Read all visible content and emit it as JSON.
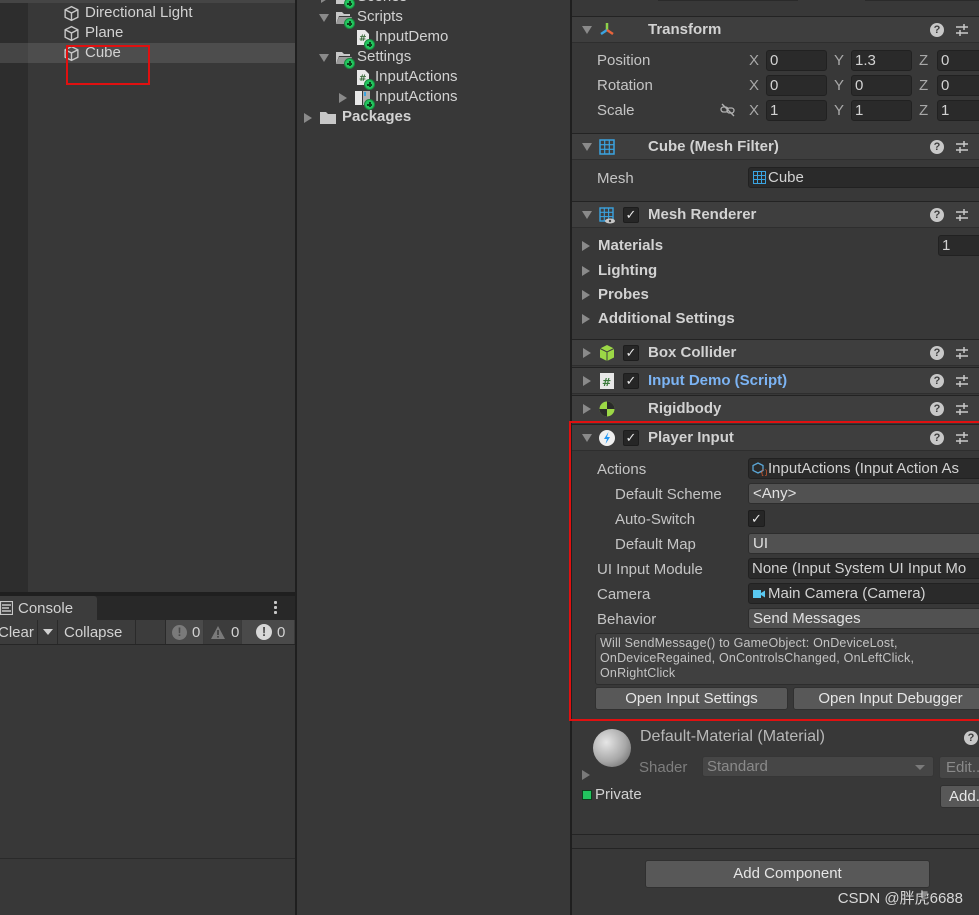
{
  "hierarchy": {
    "items": [
      {
        "label": "Directional Light",
        "icon": "gameobject-cube-icon"
      },
      {
        "label": "Plane",
        "icon": "gameobject-cube-icon"
      },
      {
        "label": "Cube",
        "icon": "gameobject-cube-icon",
        "selected": true
      }
    ],
    "highlight_color": "#e01010"
  },
  "console": {
    "tab_label": "Console",
    "clear_label": "Clear",
    "collapse_label": "Collapse",
    "info_count": "0",
    "warning_count": "0",
    "error_count": "0"
  },
  "project": {
    "items": [
      {
        "label": "Scenes",
        "type": "folder",
        "expanded": false
      },
      {
        "label": "Scripts",
        "type": "folder",
        "expanded": true
      },
      {
        "label": "InputDemo",
        "type": "script"
      },
      {
        "label": "Settings",
        "type": "folder",
        "expanded": true
      },
      {
        "label": "InputActions",
        "type": "script"
      },
      {
        "label": "InputActions",
        "type": "input-actions-asset",
        "expanded": false
      },
      {
        "label": "Packages",
        "type": "folder",
        "expanded": false
      }
    ]
  },
  "inspector": {
    "transform": {
      "title": "Transform",
      "position": {
        "label": "Position",
        "x": "0",
        "y": "1.3",
        "z": "0"
      },
      "rotation": {
        "label": "Rotation",
        "x": "0",
        "y": "0",
        "z": "0"
      },
      "scale": {
        "label": "Scale",
        "x": "1",
        "y": "1",
        "z": "1"
      }
    },
    "mesh_filter": {
      "title": "Cube (Mesh Filter)",
      "mesh_label": "Mesh",
      "mesh_value": "Cube"
    },
    "mesh_renderer": {
      "title": "Mesh Renderer",
      "enabled": true,
      "materials_label": "Materials",
      "materials_count": "1",
      "lighting_label": "Lighting",
      "probes_label": "Probes",
      "additional_label": "Additional Settings"
    },
    "box_collider": {
      "title": "Box Collider",
      "enabled": true
    },
    "input_demo": {
      "title": "Input Demo (Script)",
      "enabled": true,
      "title_color": "#7cb4f4"
    },
    "rigidbody": {
      "title": "Rigidbody"
    },
    "player_input": {
      "title": "Player Input",
      "enabled": true,
      "actions_label": "Actions",
      "actions_value": "InputActions (Input Action As",
      "default_scheme_label": "Default Scheme",
      "default_scheme_value": "<Any>",
      "auto_switch_label": "Auto-Switch",
      "auto_switch_checked": true,
      "default_map_label": "Default Map",
      "default_map_value": "UI",
      "ui_input_module_label": "UI Input Module",
      "ui_input_module_value": "None (Input System UI Input Mo",
      "camera_label": "Camera",
      "camera_value": "Main Camera (Camera)",
      "behavior_label": "Behavior",
      "behavior_value": "Send Messages",
      "help_text": "Will SendMessage() to GameObject: OnDeviceLost, OnDeviceRegained, OnControlsChanged, OnLeftClick, OnRightClick",
      "open_settings_label": "Open Input Settings",
      "open_debugger_label": "Open Input Debugger"
    },
    "material": {
      "title": "Default-Material (Material)",
      "shader_label": "Shader",
      "shader_value": "Standard",
      "edit_label": "Edit...",
      "private_label": "Private",
      "add_label": "Add..."
    },
    "add_component_label": "Add Component",
    "help_glyph": "?"
  },
  "watermark": "CSDN @胖虎6688"
}
